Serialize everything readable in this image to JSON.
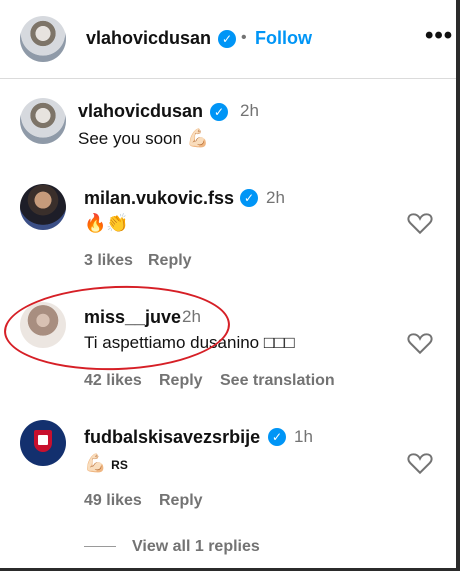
{
  "header": {
    "username": "vlahovicdusan",
    "separator": "•",
    "follow_label": "Follow",
    "more_label": "•••"
  },
  "comments": [
    {
      "username": "vlahovicdusan",
      "time": "2h",
      "text": "See you soon",
      "emoji": "💪🏻"
    },
    {
      "username": "milan.vukovic.fss",
      "time": "2h",
      "text": "",
      "emoji": "🔥👏",
      "likes": "3 likes",
      "reply_label": "Reply"
    },
    {
      "username": "miss__juve",
      "time": "2h",
      "text": "Ti aspettiamo dusanino",
      "emoji": "□□□",
      "likes": "42 likes",
      "reply_label": "Reply",
      "see_translation": "See translation"
    },
    {
      "username": "fudbalskisavezsrbije",
      "time": "1h",
      "text": "",
      "emoji": "💪🏻",
      "flag_text": "RS",
      "likes": "49 likes",
      "reply_label": "Reply"
    }
  ],
  "view_replies_label": "View all 1 replies",
  "colors": {
    "accent": "#0095f6",
    "muted": "#737373",
    "highlight_circle": "#d61f26"
  },
  "icons": [
    "verified-icon",
    "heart-icon",
    "more-options-icon"
  ]
}
